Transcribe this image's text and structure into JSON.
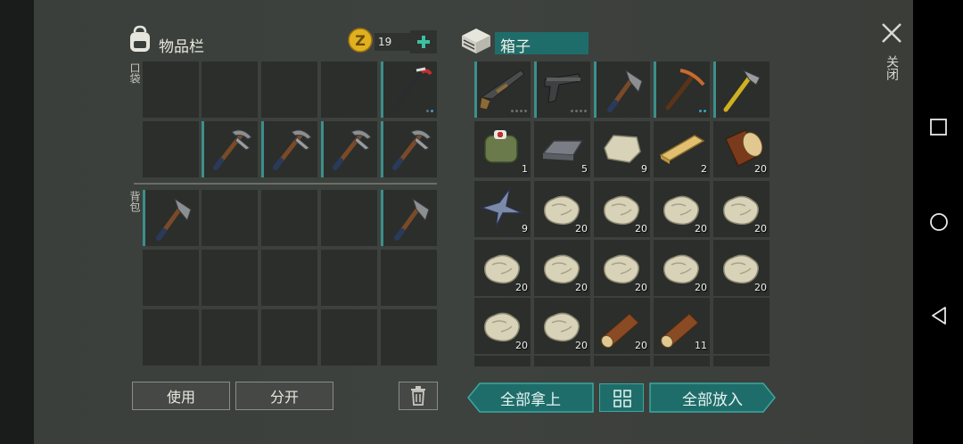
{
  "inventory": {
    "title": "物品栏",
    "coins": "19",
    "pocket_label": "口袋",
    "backpack_label": "背包",
    "use_label": "使用",
    "split_label": "分开"
  },
  "box": {
    "title": "箱子",
    "take_all_label": "全部拿上",
    "put_all_label": "全部放入"
  },
  "close_label": "关闭",
  "box_counts": {
    "r1c1": "1",
    "r1c2": "5",
    "r1c3": "9",
    "r1c4": "2",
    "r1c5": "20",
    "r2c0": "9",
    "r2c1": "20",
    "r2c2": "20",
    "r2c3": "20",
    "r2c4": "20",
    "r3c0": "20",
    "r3c1": "20",
    "r3c2": "20",
    "r3c3": "20",
    "r3c4": "20",
    "r4c0": "20",
    "r4c1": "20",
    "r4c2": "20",
    "r4c3": "11"
  },
  "colors": {
    "accent_teal": "#1f6d6a",
    "slot_bg": "#2b2e2b",
    "coin_gold": "#e0b020",
    "plus_green": "#3cc0a0"
  }
}
